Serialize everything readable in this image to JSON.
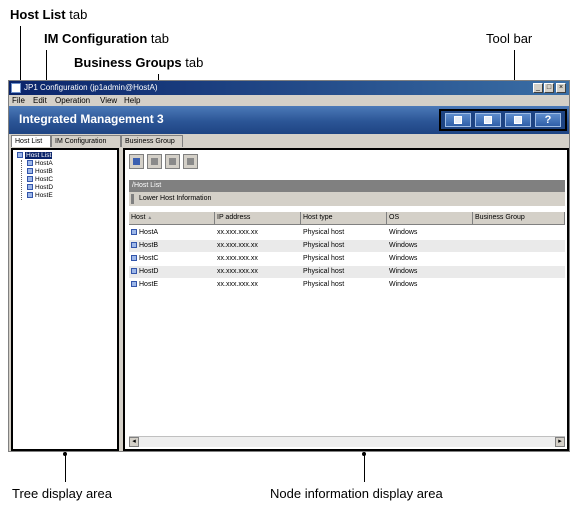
{
  "callouts": {
    "host_list_tab": {
      "bold": "Host List",
      "rest": " tab"
    },
    "im_configuration_tab": {
      "bold": "IM Configuration",
      "rest": " tab"
    },
    "business_groups_tab": {
      "bold": "Business Groups",
      "rest": " tab"
    },
    "tool_bar": "Tool bar",
    "tree_display_area": "Tree display area",
    "node_information_display_area": "Node information display area"
  },
  "window": {
    "title": "JP1 Configuration (jp1admin@HostA)",
    "controls": {
      "minimize": "_",
      "maximize": "□",
      "close": "×"
    }
  },
  "menu": [
    "File",
    "Edit",
    "Operation",
    "View",
    "Help"
  ],
  "banner": {
    "brand": "Integrated Management 3"
  },
  "toolbar": {
    "help_label": "?"
  },
  "tabs": [
    "Host List",
    "IM Configuration",
    "Business Group"
  ],
  "tree": {
    "root": "Host List",
    "hosts": [
      "HostA",
      "HostB",
      "HostC",
      "HostD",
      "HostE"
    ]
  },
  "info": {
    "path": "/Host List",
    "section": "Lower Host Information",
    "columns": [
      "Host",
      "IP address",
      "Host type",
      "OS",
      "Business Group"
    ],
    "sort_indicator": "▲",
    "rows": [
      [
        "HostA",
        "xx.xxx.xxx.xx",
        "Physical host",
        "Windows",
        ""
      ],
      [
        "HostB",
        "xx.xxx.xxx.xx",
        "Physical host",
        "Windows",
        ""
      ],
      [
        "HostC",
        "xx.xxx.xxx.xx",
        "Physical host",
        "Windows",
        ""
      ],
      [
        "HostD",
        "xx.xxx.xxx.xx",
        "Physical host",
        "Windows",
        ""
      ],
      [
        "HostE",
        "xx.xxx.xxx.xx",
        "Physical host",
        "Windows",
        ""
      ]
    ]
  }
}
